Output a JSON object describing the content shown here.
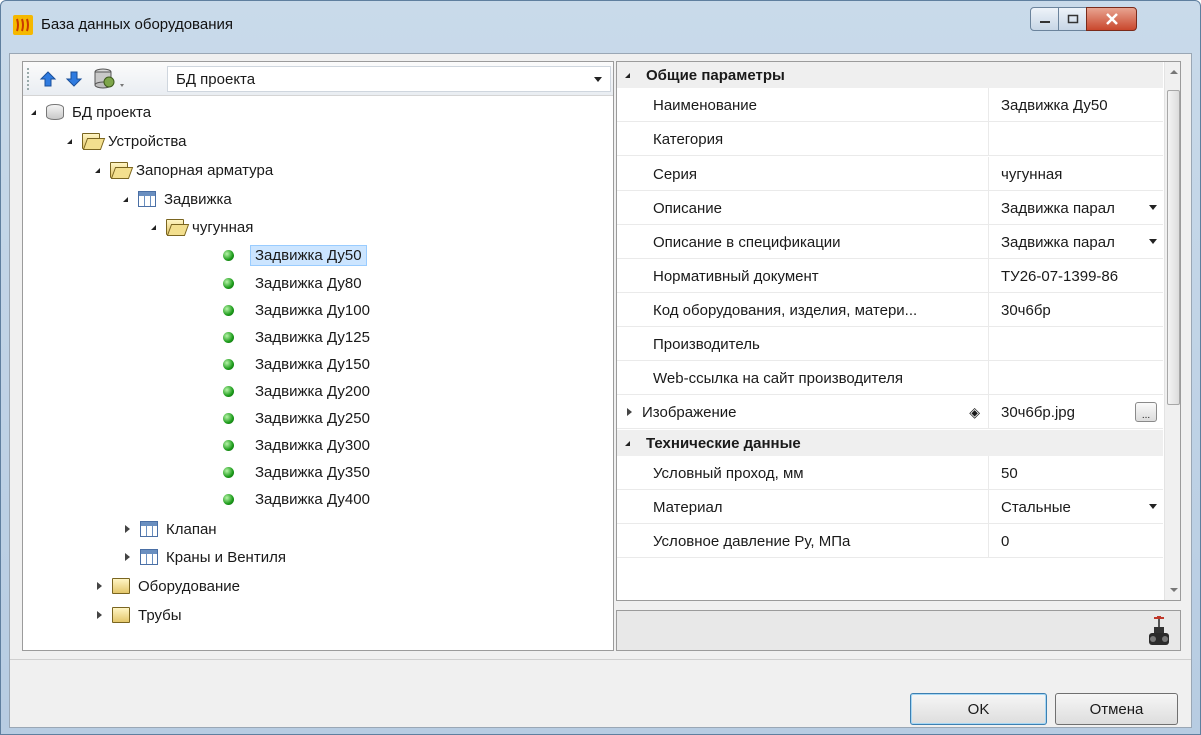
{
  "window": {
    "title": "База данных оборудования"
  },
  "toolbar": {
    "db_selector_value": "БД проекта"
  },
  "tree": {
    "root": "БД проекта",
    "devices": "Устройства",
    "shutoff": "Запорная арматура",
    "gate_valve": "Задвижка",
    "cast_iron": "чугунная",
    "items": [
      "Задвижка Ду50",
      "Задвижка Ду80",
      "Задвижка Ду100",
      "Задвижка Ду125",
      "Задвижка Ду150",
      "Задвижка Ду200",
      "Задвижка Ду250",
      "Задвижка Ду300",
      "Задвижка Ду350",
      "Задвижка Ду400"
    ],
    "valve": "Клапан",
    "taps": "Краны и Вентиля",
    "equipment": "Оборудование",
    "pipes": "Трубы"
  },
  "props": {
    "general_header": "Общие параметры",
    "tech_header": "Технические данные",
    "rows": [
      {
        "name": "Наименование",
        "value": "Задвижка Ду50"
      },
      {
        "name": "Категория",
        "value": ""
      },
      {
        "name": "Серия",
        "value": "чугунная"
      },
      {
        "name": "Описание",
        "value": "Задвижка парал"
      },
      {
        "name": "Описание в спецификации",
        "value": "Задвижка парал"
      },
      {
        "name": "Нормативный документ",
        "value": "ТУ26-07-1399-86"
      },
      {
        "name": "Код оборудования, изделия, матери...",
        "value": "30ч6бр"
      },
      {
        "name": "Производитель",
        "value": ""
      },
      {
        "name": "Web-ссылка на сайт производителя",
        "value": ""
      },
      {
        "name": "Изображение",
        "value": "30ч6бр.jpg"
      }
    ],
    "tech_rows": [
      {
        "name": "Условный проход, мм",
        "value": "50"
      },
      {
        "name": "Материал",
        "value": "Стальные"
      },
      {
        "name": "Условное давление Ру, МПа",
        "value": "0"
      }
    ],
    "ellipsis": "..."
  },
  "buttons": {
    "ok": "OK",
    "cancel": "Отмена"
  }
}
